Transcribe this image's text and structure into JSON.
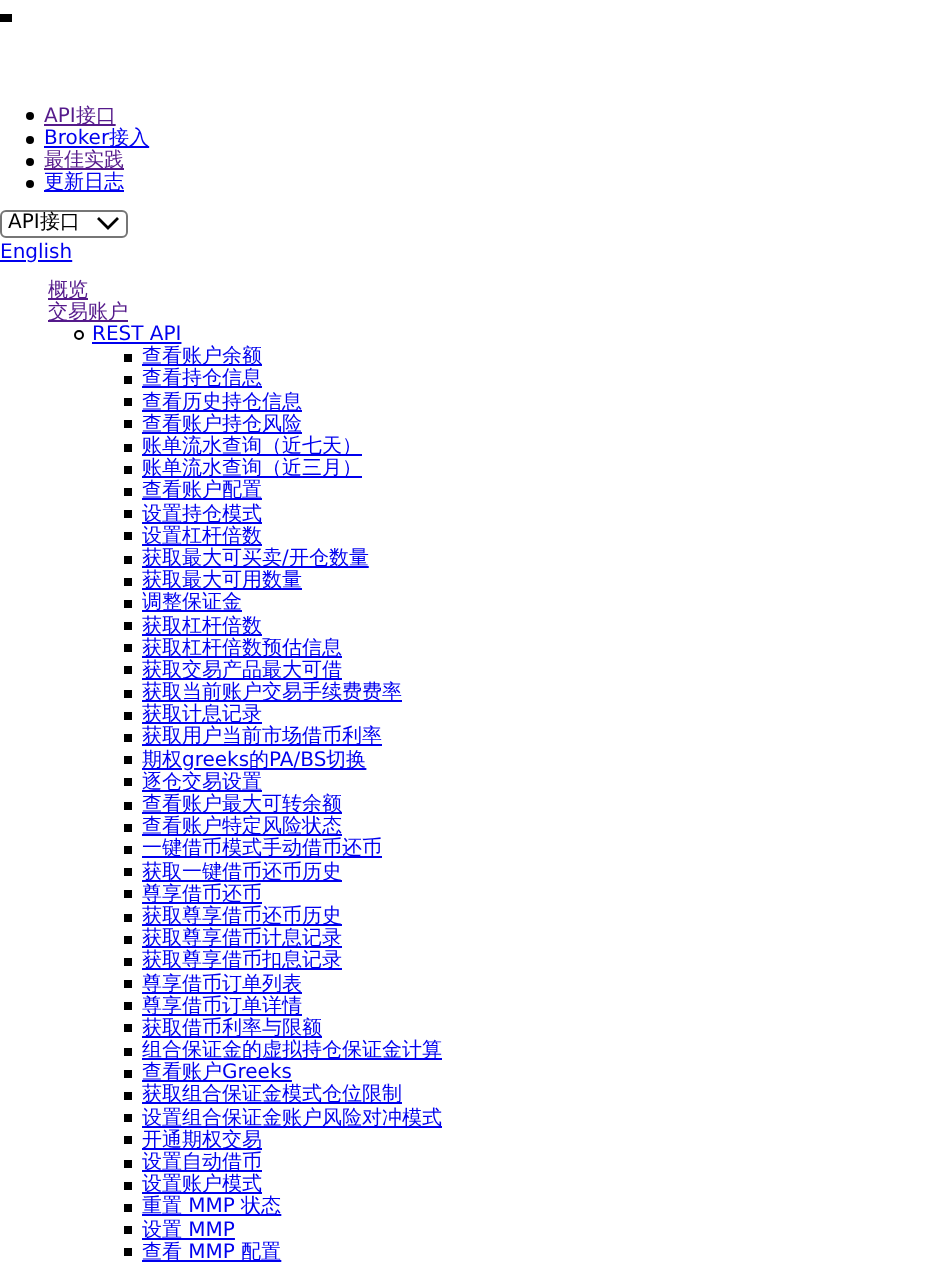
{
  "nav_links": [
    {
      "label": "API接口",
      "visited": true
    },
    {
      "label": "Broker接入",
      "visited": false
    },
    {
      "label": "最佳实践",
      "visited": true
    },
    {
      "label": "更新日志",
      "visited": false
    }
  ],
  "section_select": {
    "value": "API接口"
  },
  "language_link": {
    "label": "English",
    "visited": false
  },
  "toc": [
    {
      "label": "概览",
      "visited": true
    },
    {
      "label": "交易账户",
      "visited": true,
      "children": [
        {
          "label": "REST API",
          "visited": false,
          "children": [
            {
              "label": "查看账户余额",
              "visited": false
            },
            {
              "label": "查看持仓信息",
              "visited": false
            },
            {
              "label": "查看历史持仓信息",
              "visited": false
            },
            {
              "label": "查看账户持仓风险",
              "visited": false
            },
            {
              "label": "账单流水查询（近七天）",
              "visited": false
            },
            {
              "label": "账单流水查询（近三月）",
              "visited": false
            },
            {
              "label": "查看账户配置",
              "visited": false
            },
            {
              "label": "设置持仓模式",
              "visited": false
            },
            {
              "label": "设置杠杆倍数",
              "visited": false
            },
            {
              "label": "获取最大可买卖/开仓数量",
              "visited": false
            },
            {
              "label": "获取最大可用数量",
              "visited": false
            },
            {
              "label": "调整保证金",
              "visited": false
            },
            {
              "label": "获取杠杆倍数",
              "visited": false
            },
            {
              "label": "获取杠杆倍数预估信息",
              "visited": false
            },
            {
              "label": "获取交易产品最大可借",
              "visited": false
            },
            {
              "label": "获取当前账户交易手续费费率",
              "visited": false
            },
            {
              "label": "获取计息记录",
              "visited": false
            },
            {
              "label": "获取用户当前市场借币利率",
              "visited": false
            },
            {
              "label": "期权greeks的PA/BS切换",
              "visited": false
            },
            {
              "label": "逐仓交易设置",
              "visited": false
            },
            {
              "label": "查看账户最大可转余额",
              "visited": false
            },
            {
              "label": "查看账户特定风险状态",
              "visited": false
            },
            {
              "label": "一键借币模式手动借币还币",
              "visited": false
            },
            {
              "label": "获取一键借币还币历史",
              "visited": false
            },
            {
              "label": "尊享借币还币",
              "visited": false
            },
            {
              "label": "获取尊享借币还币历史",
              "visited": false
            },
            {
              "label": "获取尊享借币计息记录",
              "visited": false
            },
            {
              "label": "获取尊享借币扣息记录",
              "visited": false
            },
            {
              "label": "尊享借币订单列表",
              "visited": false
            },
            {
              "label": "尊享借币订单详情",
              "visited": false
            },
            {
              "label": "获取借币利率与限额",
              "visited": false
            },
            {
              "label": "组合保证金的虚拟持仓保证金计算",
              "visited": false
            },
            {
              "label": "查看账户Greeks",
              "visited": false
            },
            {
              "label": "获取组合保证金模式仓位限制",
              "visited": false
            },
            {
              "label": "设置组合保证金账户风险对冲模式",
              "visited": false
            },
            {
              "label": "开通期权交易",
              "visited": false
            },
            {
              "label": "设置自动借币",
              "visited": false
            },
            {
              "label": "设置账户模式",
              "visited": false
            },
            {
              "label": "重置 MMP 状态",
              "visited": false
            },
            {
              "label": "设置 MMP",
              "visited": false
            },
            {
              "label": "查看 MMP 配置",
              "visited": false
            }
          ]
        }
      ]
    }
  ]
}
